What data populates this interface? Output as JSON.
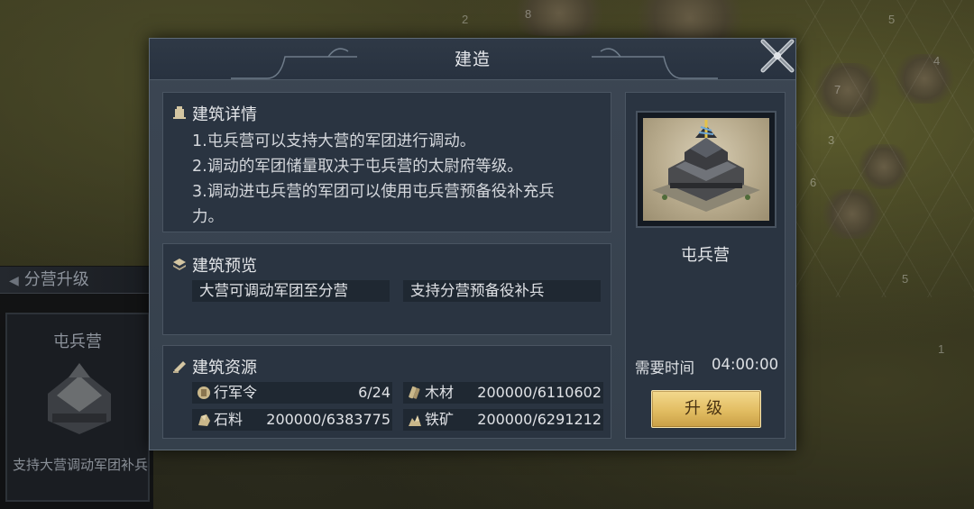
{
  "dialog": {
    "title": "建造"
  },
  "details": {
    "heading": "建筑详情",
    "lines": [
      "1.屯兵营可以支持大营的军团进行调动。",
      "2.调动的军团储量取决于屯兵营的太尉府等级。",
      "3.调动进屯兵营的军团可以使用屯兵营预备役补充兵",
      "力。"
    ]
  },
  "preview": {
    "heading": "建筑预览",
    "tags": [
      "大营可调动军团至分营",
      "支持分营预备役补兵"
    ]
  },
  "resources": {
    "heading": "建筑资源",
    "items": [
      {
        "name": "行军令",
        "value": "6/24",
        "icon": "scroll-icon"
      },
      {
        "name": "木材",
        "value": "200000/6110602",
        "icon": "wood-icon"
      },
      {
        "name": "石料",
        "value": "200000/6383775",
        "icon": "stone-icon"
      },
      {
        "name": "铁矿",
        "value": "200000/6291212",
        "icon": "iron-icon"
      }
    ]
  },
  "building": {
    "name": "屯兵营",
    "time_label": "需要时间",
    "time_value": "04:00:00",
    "upgrade_label": "升级"
  },
  "sidebar": {
    "title": "分营升级",
    "card_name": "屯兵营",
    "card_desc": "支持大营调动军团补兵"
  },
  "map_numbers": [
    "2",
    "8",
    "5",
    "7",
    "6",
    "3",
    "4",
    "5",
    "1"
  ],
  "colors": {
    "accent_gold": "#e2bd62",
    "dialog_bg": "#35404c",
    "panel_bg": "#2a3441"
  }
}
